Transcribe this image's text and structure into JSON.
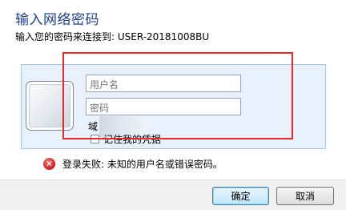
{
  "dialog": {
    "title": "输入网络密码",
    "subtitle": "输入您的密码来连接到: USER-20181008BU"
  },
  "credentials": {
    "username_placeholder": "用户名",
    "password_placeholder": "密码",
    "domain_label": "域",
    "remember_label": "记住我的凭据",
    "remember_checked": false
  },
  "error": {
    "icon": "error-x-icon",
    "message": "登录失败: 未知的用户名或错误密码。"
  },
  "buttons": {
    "ok_label": "确定",
    "cancel_label": "取消"
  },
  "colors": {
    "title": "#1e3f90",
    "panel_background": "#e8f1fc",
    "annotation_box": "#e32b2b",
    "error_icon": "#d4232a"
  }
}
